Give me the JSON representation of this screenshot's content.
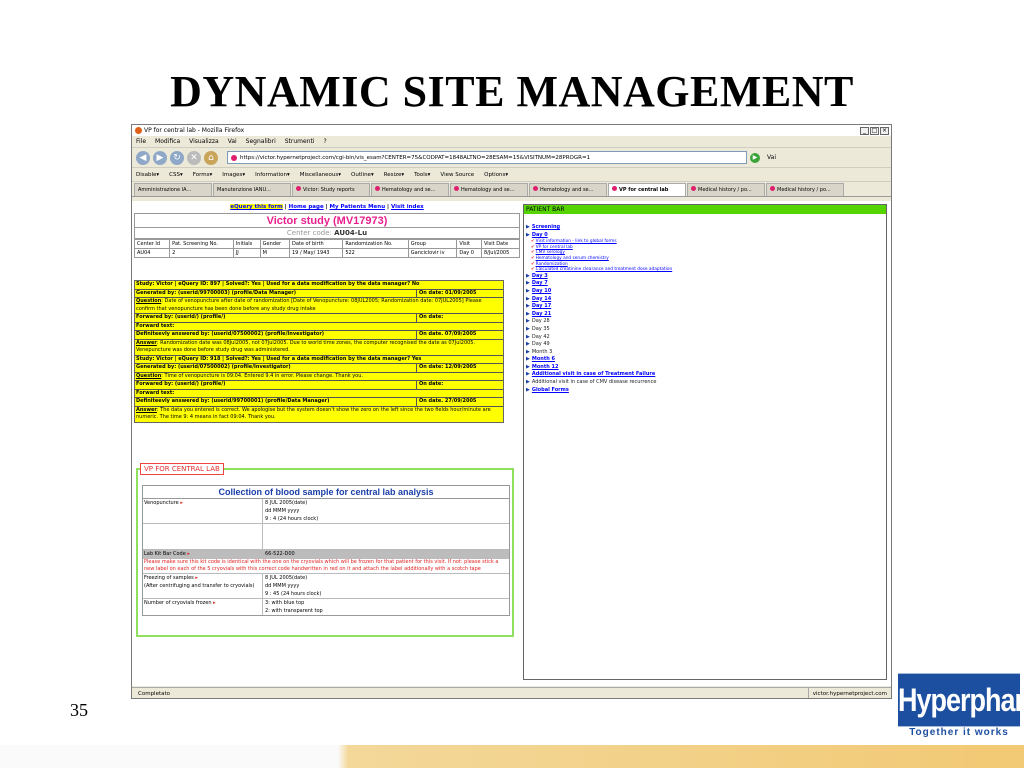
{
  "slide": {
    "title": "DYNAMIC SITE MANAGEMENT",
    "page_number": "35"
  },
  "browser": {
    "window_title": "VP for central lab - Mozilla Firefox",
    "menu": [
      "File",
      "Modifica",
      "Visualizza",
      "Vai",
      "Segnalibri",
      "Strumenti",
      "?"
    ],
    "url": "https://victor.hypernetproject.com/cgi-bin/vis_esam?CENTER=75&CODPAT=1848ALTNO=28ESAM=15&VISITNUM=28PROGR=1",
    "go_label": "Vai",
    "toolbar": [
      "Disable▾",
      "CSS▾",
      "Forms▾",
      "Images▾",
      "Information▾",
      "Miscellaneous▾",
      "Outline▾",
      "Resize▾",
      "Tools▾",
      "View Source",
      "Options▾"
    ],
    "tabs": [
      "Amministrazione IA...",
      "Manutenzione IANU...",
      "Victor: Study reports",
      "Hematology and se...",
      "Hematology and se...",
      "Hematology and se...",
      "VP for central lab",
      "Medical history / po...",
      "Medical history / po..."
    ],
    "status_left": "Completato",
    "status_right": "victor.hypernetproject.com"
  },
  "page": {
    "links": {
      "equery": "eQuery this form",
      "home": "Home page",
      "patients": "My Patients Menu",
      "visit": "Visit index"
    },
    "study_title": "Victor study (MV17973)",
    "center_code_label": "Center code:",
    "center_code_value": "AU04-Lu",
    "patient_headers": [
      "Center Id",
      "Pat. Screening No.",
      "Initials",
      "Gender",
      "Date of birth",
      "Randomization No.",
      "Group",
      "Visit",
      "Visit Date"
    ],
    "patient_values": [
      "AU04",
      "2",
      "JJ",
      "M",
      "19 / May/ 1943",
      "522",
      "Ganciclovir iv",
      "Day 0",
      "8/Jul/2005"
    ]
  },
  "query": {
    "q1_header": "Study: Victor | eQuery ID: 897 | Solved?: Yes | Used for a data modification by the data manager? No",
    "q1_generated": "Generated by: (userid/99700003) (profile/Data Manager)",
    "q1_generated_date": "On date: 01/09/2005",
    "q1_question_label": "Question",
    "q1_question": ": Date of venopuncture after date of randomization [Date of Venopuncture: 08JUL2005; Randomization date: 07JUL2005] Please confirm that venopuncture has been done before any study drug intake",
    "q1_forwarded": "Forwared by: (userid/) (profile/)",
    "q1_forwarded_date": "On date:",
    "q1_forward_text": "Forward text:",
    "q1_answered": "Definiteevly answered by: (userid/07500002) (profile/Investigator)",
    "q1_answered_date": "On date. 07/09/2005",
    "q1_answer_label": "Answer",
    "q1_answer": ": Randomization date was 08Jul2005, not 07Jul2005. Due to world time zones, the computer recognised the date as 07Jul2005. Venepuncture was done before study drug was administered.",
    "q2_header": "Study: Victor | eQuery ID: 918 | Solved?: Yes | Used for a data modification by the data manager? Yes",
    "q2_generated": "Generated by: (userid/07500002) (profile/Investigator)",
    "q2_generated_date": "On date: 12/09/2005",
    "q2_question_label": "Question",
    "q2_question": ": Time of venopuncture is 09:04. Entered 9.4 in error. Please change. Thank you.",
    "q2_forwarded": "Forwared by: (userid/) (profile/)",
    "q2_forwarded_date": "On date:",
    "q2_forward_text": "Forward text:",
    "q2_answered": "Definiteevly answered by: (userid/99700001) (profile/Data Manager)",
    "q2_answered_date": "On date. 27/09/2005",
    "q2_answer_label": "Answer",
    "q2_answer": ": The data you entered is correct. We apologise but the system doesn't show the zero on the left since the two fields hour/minute are numeric. The time 9: 4 means in fact 09:04. Thank you."
  },
  "form": {
    "box_title": "VP FOR CENTRAL LAB",
    "title": "Collection of blood sample for central lab analysis",
    "venopuncture_label": "Venopuncture",
    "veno_date": "8  JUL  2005(date)",
    "veno_date_fmt": "dd MMM  yyyy",
    "veno_time": "9 : 4  (24 hours clock)",
    "kit_label": "Lab Kit Bar Code",
    "kit_value": "66-522-D00",
    "warning": "Please make sure this kit code is identical with the one on the cryovials which will be frozen for that patient for this visit. If not: please stick a new label on each of the 5 cryovials with this correct code handwritten in red on it and attach the label additionally with a scotch tape",
    "freezing_label": "Freezing of samples",
    "freezing_note": "(After centrifuging and transfer to cryovials)",
    "freeze_date": "8  JUL  2005(date)",
    "freeze_date_fmt": "dd MMM  yyyy",
    "freeze_time": "9 : 45  (24 hours clock)",
    "cryovials_label": "Number of cryovials frozen",
    "cryo1": "3: with blue top",
    "cryo2": "2: with transparent top"
  },
  "patient_bar": {
    "title": "PATIENT BAR",
    "items": [
      {
        "label": "Screening",
        "type": "link"
      },
      {
        "label": "Day 0",
        "type": "link"
      },
      {
        "label": "Visit information - link to global forms",
        "type": "sub"
      },
      {
        "label": "VP for central lab",
        "type": "sub"
      },
      {
        "label": "CMV serology",
        "type": "sub"
      },
      {
        "label": "Hematology and serum chemistry",
        "type": "sub"
      },
      {
        "label": "Randomization",
        "type": "sub"
      },
      {
        "label": "Calculated creatinine clearance and treatment dose adaptation",
        "type": "sub"
      },
      {
        "label": "Day 3",
        "type": "link"
      },
      {
        "label": "Day 7",
        "type": "link"
      },
      {
        "label": "Day 10",
        "type": "link"
      },
      {
        "label": "Day 14",
        "type": "link"
      },
      {
        "label": "Day 17",
        "type": "link"
      },
      {
        "label": "Day 21",
        "type": "link"
      },
      {
        "label": "Day 28",
        "type": "plain"
      },
      {
        "label": "Day 35",
        "type": "plain"
      },
      {
        "label": "Day 42",
        "type": "plain"
      },
      {
        "label": "Day 49",
        "type": "plain"
      },
      {
        "label": "Month 3",
        "type": "plain"
      },
      {
        "label": "Month 6",
        "type": "link"
      },
      {
        "label": "Month 12",
        "type": "link"
      },
      {
        "label": "Additional visit in case of Treatment Failure",
        "type": "link"
      },
      {
        "label": "Additional visit in case of CMV disease recurrence",
        "type": "plain"
      },
      {
        "label": "Global Forms",
        "type": "link"
      }
    ]
  },
  "logo": {
    "name": "Hyperphar",
    "tagline": "Together it works"
  }
}
